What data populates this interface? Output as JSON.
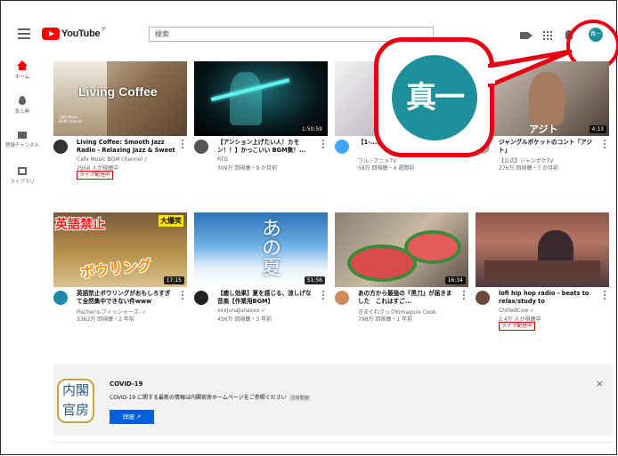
{
  "header": {
    "logo_text": "YouTube",
    "logo_region": "JP",
    "search_placeholder": "検索",
    "avatar_text": "真一"
  },
  "sidebar": {
    "items": [
      {
        "label": "ホーム",
        "icon": "home-icon",
        "active": true
      },
      {
        "label": "急上昇",
        "icon": "trending-icon"
      },
      {
        "label": "登録チャンネル",
        "icon": "subscriptions-icon"
      },
      {
        "label": "ライブラリ",
        "icon": "library-icon"
      }
    ]
  },
  "thumb_text": {
    "living_coffee": "Living Coffee",
    "living_coffee_small": "Cafe Music\nBGM channel",
    "bowling_top": "英語禁止",
    "bowling_badge": "大爆笑",
    "bowling_bottom": "ボウリング",
    "summer": "あの夏",
    "jungle": "アジト"
  },
  "videos": [
    {
      "title": "Living Coffee: Smooth Jazz Radio - Relaxing Jazz & Sweet ...",
      "channel": "Cafe Music BGM channel ♪",
      "stats": "2958 人が視聴中",
      "badge": "ライブ配信中",
      "duration": "",
      "avatar_color": "#333333"
    },
    {
      "title": "【アンション上げたい人！カモン！！】かっこいい BGM集！...",
      "channel": "RTG",
      "stats": "309万 回視聴・9 か月前",
      "badge": "",
      "duration": "1:50:59",
      "avatar_color": "#555555"
    },
    {
      "title": "【1-...(%)ま...",
      "channel": "フル☆アニメTV",
      "stats": "58万 回視聴・4 週間前",
      "badge": "",
      "duration": "",
      "avatar_color": "#3ea6ff"
    },
    {
      "title": "ジャングルポケットのコント「アジト」",
      "channel": "【公式】ジャンポケTV",
      "stats": "276万 回視聴・7 か月前",
      "badge": "",
      "duration": "4:13",
      "avatar_color": "#aaaaaa"
    },
    {
      "title": "英語禁止ボウリングがおもしろすぎて全然集中できない件www",
      "channel": "Fischer's-フィッシャーズ- ✓",
      "stats": "3362万 回視聴・2 年前",
      "badge": "",
      "duration": "17:15",
      "avatar_color": "#1e88a8"
    },
    {
      "title": "【癒し効果】夏を感じる、涼しげな音楽【作業用BGM】",
      "channel": "xxxJunaJunaxxx ✓",
      "stats": "456万 回視聴・3 年前",
      "badge": "",
      "duration": "51:56",
      "avatar_color": "#222222"
    },
    {
      "title": "あの方から最強の『黒刀』が届きました　これはすご...",
      "channel": "きまぐれクックKimagure Cook",
      "stats": "798万 回視聴・1 年前",
      "badge": "",
      "duration": "16:34",
      "avatar_color": "#d08a5a"
    },
    {
      "title": "lofi hip hop radio - beats to relax/study to",
      "channel": "ChilledCow ✓",
      "stats": "2.4万 人が視聴中",
      "badge": "ライブ配信中",
      "duration": "",
      "avatar_color": "#6b4a3a"
    }
  ],
  "covid": {
    "logo_line1": "内閣",
    "logo_line2": "官房",
    "title": "COVID-19",
    "text": "COVID-19 に関する最新の情報は内閣官房ホームページをご参照ください",
    "tag": "注目動画",
    "button_label": "詳細 ↗",
    "close": "×"
  }
}
